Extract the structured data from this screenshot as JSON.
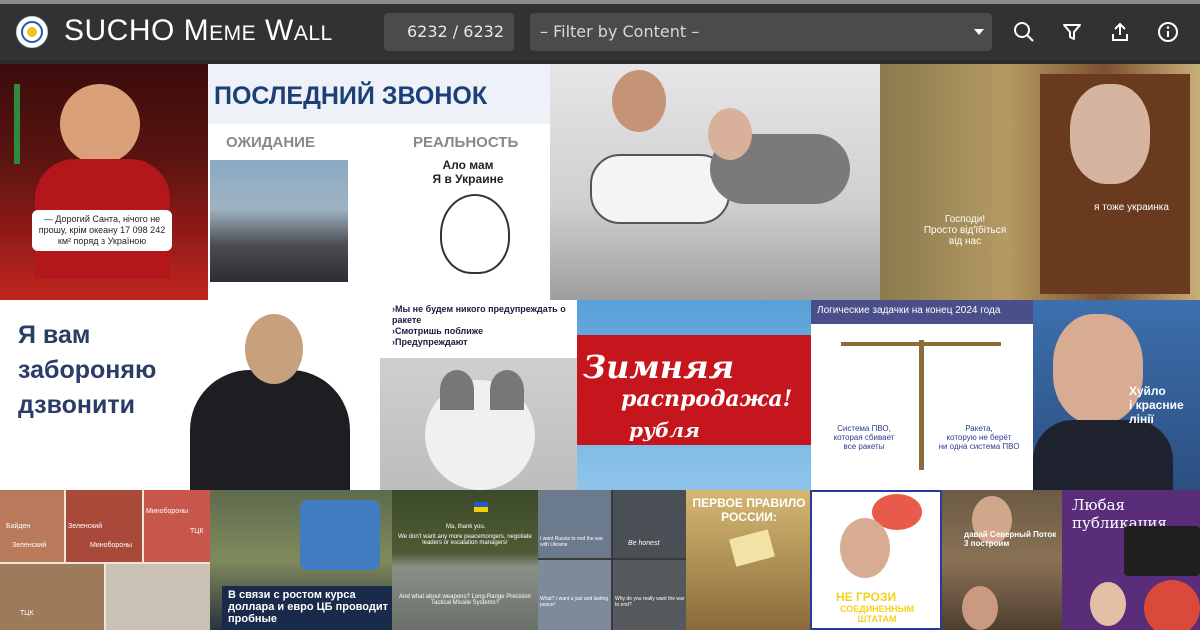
{
  "app": {
    "title": "SUCHO Meme Wall",
    "counter": "6232 / 6232",
    "filter_placeholder": "– Filter by Content –"
  },
  "icons": {
    "search": "search-icon",
    "filter": "filter-icon",
    "share": "share-icon",
    "info": "info-icon"
  },
  "colors": {
    "header_bg": "#323232",
    "field_bg": "#4b4b4b",
    "text": "#ffffff"
  },
  "memes": {
    "santa": "— Дорогий Санта, нічого не прошу, крім океану 17 098 242 км² поряд з Україною",
    "zvonok_title": "ПОСЛЕДНИЙ ЗВОНОК",
    "zvonok_left": "ОЖИДАНИЕ",
    "zvonok_right": "РЕАЛЬНОСТЬ",
    "zvonok_quote": "Ало мам\nЯ в Украине",
    "door_left": "Господи!\nПросто від'їбіться\nвід нас",
    "door_right": "я тоже украинка",
    "zel_text": "Я вам\nзабороняю\nдзвонити",
    "cat_text": "›Мы не будем никого предупреждать о ракете\n›Смотришь поближе\n›Предупреждают",
    "sale_1": "Зимняя",
    "sale_2": "распродажа!",
    "sale_3": "рубля",
    "logic_title": "Логические задачки на конец 2024 года",
    "logic_left": "Система ПВО,\nкоторая сбивает\nвсе ракеты",
    "logic_right": "Ракета,\nкоторую не берёт\nни одна система ПВО",
    "putin_text": "Хуйло\nі красние\nлінії",
    "comic_1": "Байден",
    "comic_2": "Зеленский",
    "comic_3": "Зеленский",
    "comic_4": "Минобороны",
    "comic_5": "Минобороны",
    "comic_6": "ТЦК",
    "comic_7": "ТЦК",
    "money_text": "В связи с ростом курса доллара и евро ЦБ проводит пробные",
    "gandalf_1": "Ma, thank you.",
    "gandalf_2": "We don't want any more peacemongers, negotiate leaders or escalation managers!",
    "gandalf_3": "And what about weapons? Long-Range Precision Tactical Missile Systems?",
    "scholz_1": "I want Russia to end the war with Ukraine",
    "scholz_2": "Be honest",
    "scholz_3": "What? I want a just and lasting peace!",
    "scholz_4": "Why do you really want the war to end?",
    "rule_title": "ПЕРВОЕ ПРАВИЛО РОССИИ:",
    "medvedev_1": "НЕ ГРОЗИ",
    "medvedev_2": "СОЕДИНЕННЫМ ШТАТАМ",
    "nord_text": "давай Северный Поток 3 построим",
    "pub_text": "Любая публикация"
  }
}
